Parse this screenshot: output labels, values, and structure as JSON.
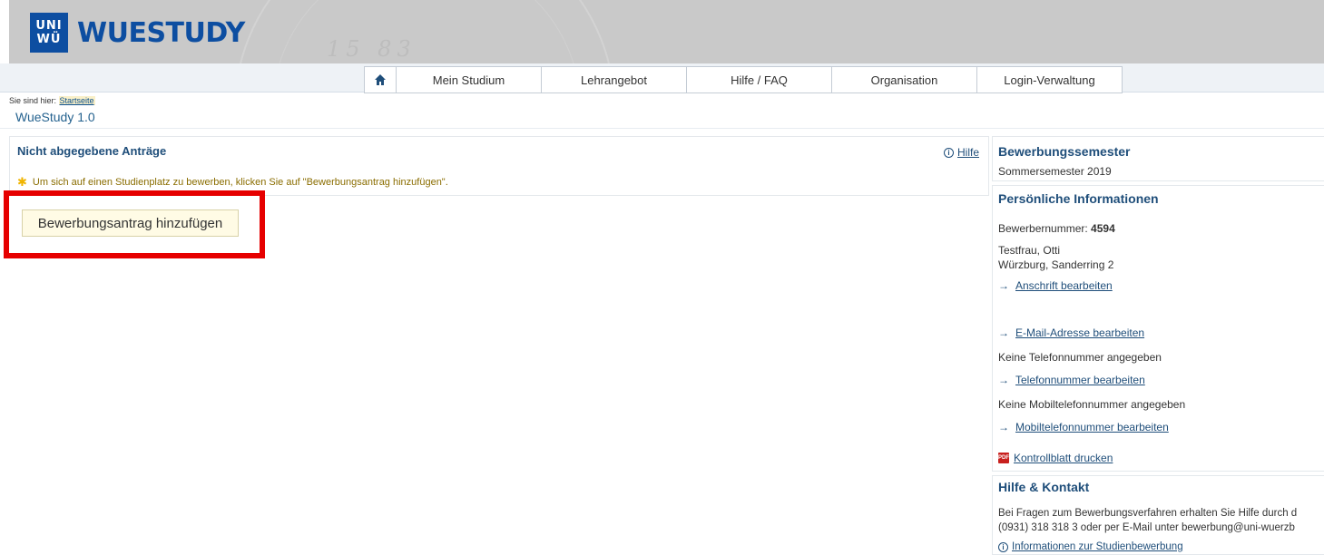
{
  "header": {
    "logo_uni_line1": "UNI",
    "logo_uni_line2": "WÜ",
    "logo_text": "WUESTUDY",
    "seal_text": "15 83"
  },
  "nav": {
    "items": [
      {
        "label": "Mein Studium"
      },
      {
        "label": "Lehrangebot"
      },
      {
        "label": "Hilfe / FAQ"
      },
      {
        "label": "Organisation"
      },
      {
        "label": "Login-Verwaltung"
      }
    ]
  },
  "breadcrumb": {
    "prefix": "Sie sind hier:",
    "link": "Startseite"
  },
  "page_title": "WueStudy 1.0",
  "main": {
    "panel_title": "Nicht abgegebene Anträge",
    "help_icon": "ⓘ",
    "help_label": "Hilfe",
    "info_text": "Um sich auf einen Studienplatz zu bewerben, klicken Sie auf \"Bewerbungsantrag hinzufügen\".",
    "add_button_label": "Bewerbungsantrag hinzufügen"
  },
  "sidebar": {
    "semester": {
      "title": "Bewerbungssemester",
      "value": "Sommersemester 2019"
    },
    "personal": {
      "title": "Persönliche Informationen",
      "applicant_label": "Bewerbernummer:",
      "applicant_number": "4594",
      "name": "Testfrau, Otti",
      "address": "Würzburg, Sanderring 2",
      "edit_address": "Anschrift bearbeiten",
      "edit_email": "E-Mail-Adresse bearbeiten",
      "no_phone": "Keine Telefonnummer angegeben",
      "edit_phone": "Telefonnummer bearbeiten",
      "no_mobile": "Keine Mobiltelefonnummer angegeben",
      "edit_mobile": "Mobiltelefonnummer bearbeiten",
      "print_label": "Kontrollblatt drucken",
      "pdf_icon_text": "PDF"
    },
    "help": {
      "title": "Hilfe & Kontakt",
      "line1": "Bei Fragen zum Bewerbungsverfahren erhalten Sie Hilfe durch d",
      "line2": "(0931) 318 318 3 oder per E-Mail unter bewerbung@uni-wuerzb",
      "info_link": "Informationen zur Studienbewerbung"
    }
  },
  "colors": {
    "accent": "#1f4e7a",
    "highlight": "#e60000",
    "logo_blue": "#0d4ea1"
  }
}
